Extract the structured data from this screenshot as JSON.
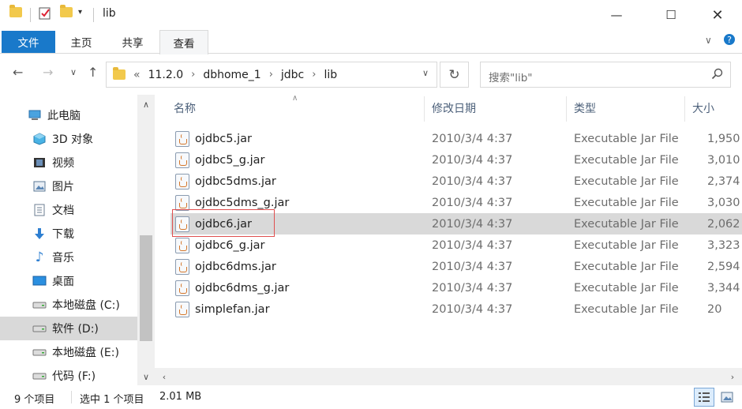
{
  "window": {
    "title": "lib"
  },
  "ribbon": {
    "tabs": [
      {
        "label": "文件"
      },
      {
        "label": "主页"
      },
      {
        "label": "共享"
      },
      {
        "label": "查看"
      }
    ]
  },
  "address": {
    "overflow": "«",
    "crumbs": [
      "11.2.0",
      "dbhome_1",
      "jdbc",
      "lib"
    ]
  },
  "search": {
    "placeholder": "搜索\"lib\""
  },
  "nav": {
    "items": [
      {
        "label": "此电脑",
        "icon": "computer-icon"
      },
      {
        "label": "3D 对象",
        "icon": "cube-icon"
      },
      {
        "label": "视频",
        "icon": "video-icon"
      },
      {
        "label": "图片",
        "icon": "picture-icon"
      },
      {
        "label": "文档",
        "icon": "document-icon"
      },
      {
        "label": "下载",
        "icon": "download-icon"
      },
      {
        "label": "音乐",
        "icon": "music-icon"
      },
      {
        "label": "桌面",
        "icon": "desktop-icon"
      },
      {
        "label": "本地磁盘 (C:)",
        "icon": "drive-icon"
      },
      {
        "label": "软件 (D:)",
        "icon": "drive-icon",
        "selected": true
      },
      {
        "label": "本地磁盘 (E:)",
        "icon": "drive-icon"
      },
      {
        "label": "代码 (F:)",
        "icon": "drive-icon"
      }
    ]
  },
  "columns": {
    "name": "名称",
    "date": "修改日期",
    "type": "类型",
    "size": "大小"
  },
  "files": [
    {
      "name": "ojdbc5.jar",
      "date": "2010/3/4 4:37",
      "type": "Executable Jar File",
      "size": "1,950"
    },
    {
      "name": "ojdbc5_g.jar",
      "date": "2010/3/4 4:37",
      "type": "Executable Jar File",
      "size": "3,010"
    },
    {
      "name": "ojdbc5dms.jar",
      "date": "2010/3/4 4:37",
      "type": "Executable Jar File",
      "size": "2,374"
    },
    {
      "name": "ojdbc5dms_g.jar",
      "date": "2010/3/4 4:37",
      "type": "Executable Jar File",
      "size": "3,030"
    },
    {
      "name": "ojdbc6.jar",
      "date": "2010/3/4 4:37",
      "type": "Executable Jar File",
      "size": "2,062",
      "selected": true
    },
    {
      "name": "ojdbc6_g.jar",
      "date": "2010/3/4 4:37",
      "type": "Executable Jar File",
      "size": "3,323"
    },
    {
      "name": "ojdbc6dms.jar",
      "date": "2010/3/4 4:37",
      "type": "Executable Jar File",
      "size": "2,594"
    },
    {
      "name": "ojdbc6dms_g.jar",
      "date": "2010/3/4 4:37",
      "type": "Executable Jar File",
      "size": "3,344"
    },
    {
      "name": "simplefan.jar",
      "date": "2010/3/4 4:37",
      "type": "Executable Jar File",
      "size": "20"
    }
  ],
  "status": {
    "count": "9 个项目",
    "selection": "选中 1 个项目",
    "size": "2.01 MB"
  },
  "colors": {
    "accent": "#1979ca",
    "selection": "#d9d9d9",
    "highlight_frame": "#e05050"
  }
}
